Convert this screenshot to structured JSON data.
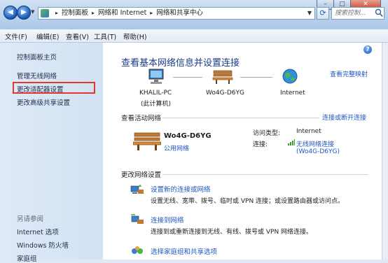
{
  "window": {
    "minimize_glyph": "–",
    "maximize_glyph": "□",
    "close_glyph": "✕"
  },
  "address_bar": {
    "crumbs": [
      "控制面板",
      "网络和 Internet",
      "网络和共享中心"
    ],
    "separator": "▸"
  },
  "search": {
    "placeholder": "搜索控制..."
  },
  "menu": [
    "文件(F)",
    "编辑(E)",
    "查看(V)",
    "工具(T)",
    "帮助(H)"
  ],
  "sidebar": {
    "home": "控制面板主页",
    "links": [
      "管理无线网络",
      "更改适配器设置",
      "更改高级共享设置"
    ],
    "see_also_title": "另请参阅",
    "see_also": [
      "Internet 选项",
      "Windows 防火墙",
      "家庭组"
    ]
  },
  "main": {
    "title": "查看基本网络信息并设置连接",
    "view_full_map": "查看完整映射",
    "nodes": [
      {
        "label": "KHALIL-PC",
        "sublabel": "(此计算机)",
        "icon": "computer-icon"
      },
      {
        "label": "Wo4G-D6YG",
        "icon": "bench-icon"
      },
      {
        "label": "Internet",
        "icon": "globe-icon"
      }
    ],
    "active_networks_title": "查看活动网络",
    "connect_disconnect": "连接或断开连接",
    "active_network": {
      "name": "Wo4G-D6YG",
      "type": "公用网络",
      "access_type_label": "访问类型:",
      "access_type_value": "Internet",
      "connections_label": "连接:",
      "connection_link": "无线网络连接",
      "connection_ssid": "(Wo4G-D6YG)"
    },
    "change_settings_title": "更改网络设置",
    "tasks": [
      {
        "title": "设置新的连接或网络",
        "desc": "设置无线、宽带、拨号、临时或 VPN 连接；或设置路由器或访问点。"
      },
      {
        "title": "连接到网络",
        "desc": "连接到或重新连接到无线、有线、拨号或 VPN 网络连接。"
      },
      {
        "title": "选择家庭组和共享选项",
        "desc": ""
      }
    ]
  },
  "colors": {
    "highlight": "#e03a2f",
    "link": "#1f57c3",
    "heading": "#1b3b8a"
  }
}
